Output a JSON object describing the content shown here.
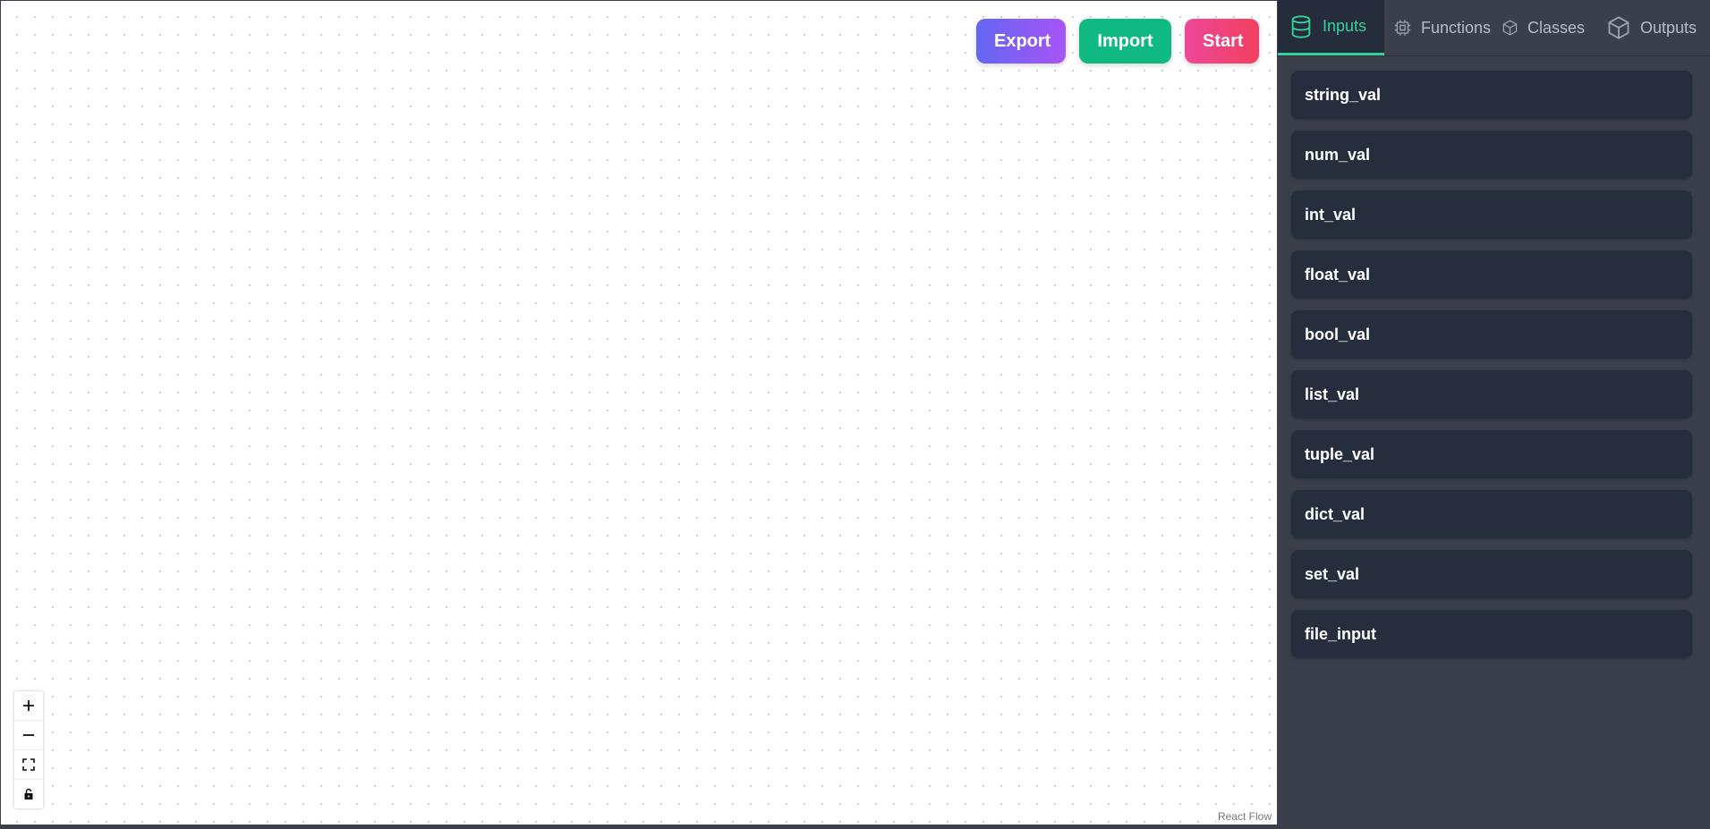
{
  "toolbar": {
    "export_label": "Export",
    "import_label": "Import",
    "start_label": "Start"
  },
  "canvas": {
    "attribution": "React Flow",
    "controls": [
      "zoom-in",
      "zoom-out",
      "fit-view",
      "lock"
    ]
  },
  "sidebar": {
    "tabs": [
      {
        "label": "Inputs",
        "icon": "database-icon",
        "active": true
      },
      {
        "label": "Functions",
        "icon": "chip-icon",
        "active": false
      },
      {
        "label": "Classes",
        "icon": "cube-icon",
        "active": false
      },
      {
        "label": "Outputs",
        "icon": "cube-icon",
        "active": false
      }
    ],
    "items": [
      {
        "label": "string_val"
      },
      {
        "label": "num_val"
      },
      {
        "label": "int_val"
      },
      {
        "label": "float_val"
      },
      {
        "label": "bool_val"
      },
      {
        "label": "list_val"
      },
      {
        "label": "tuple_val"
      },
      {
        "label": "dict_val"
      },
      {
        "label": "set_val"
      },
      {
        "label": "file_input"
      }
    ]
  },
  "colors": {
    "accent": "#34d399",
    "sidebar_bg": "#3a3f4b",
    "item_bg": "#262e3e",
    "import": "#10b981"
  }
}
